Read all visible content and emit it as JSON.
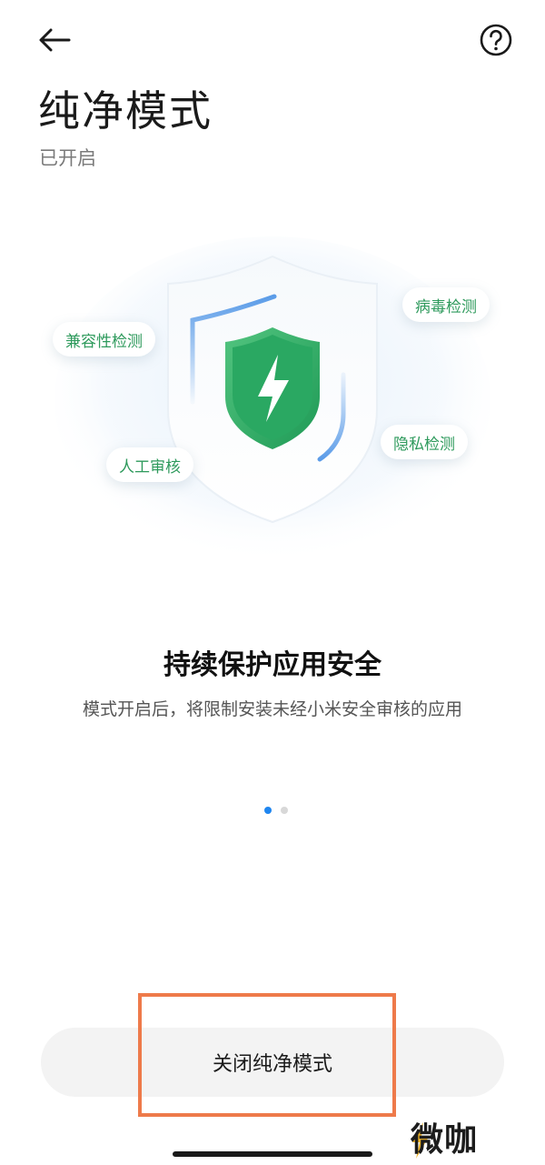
{
  "header": {
    "back_icon": "arrow-left-icon",
    "help_icon": "question-circle-icon",
    "title": "纯净模式",
    "status": "已开启"
  },
  "hero": {
    "icon": "shield-lightning-icon",
    "features": {
      "compatibility": "兼容性检测",
      "virus": "病毒检测",
      "manual_review": "人工审核",
      "privacy": "隐私检测"
    }
  },
  "content": {
    "headline": "持续保护应用安全",
    "description": "模式开启后，将限制安装未经小米安全审核的应用"
  },
  "pager": {
    "count": 2,
    "active_index": 0
  },
  "footer": {
    "close_button_label": "关闭纯净模式"
  },
  "watermark": {
    "text": "微咖"
  },
  "colors": {
    "accent_green": "#2e9a5c",
    "shield_green": "#34b06a",
    "pager_active": "#1f86f0",
    "highlight": "#ee7a4a",
    "button_bg": "#f3f3f3"
  }
}
